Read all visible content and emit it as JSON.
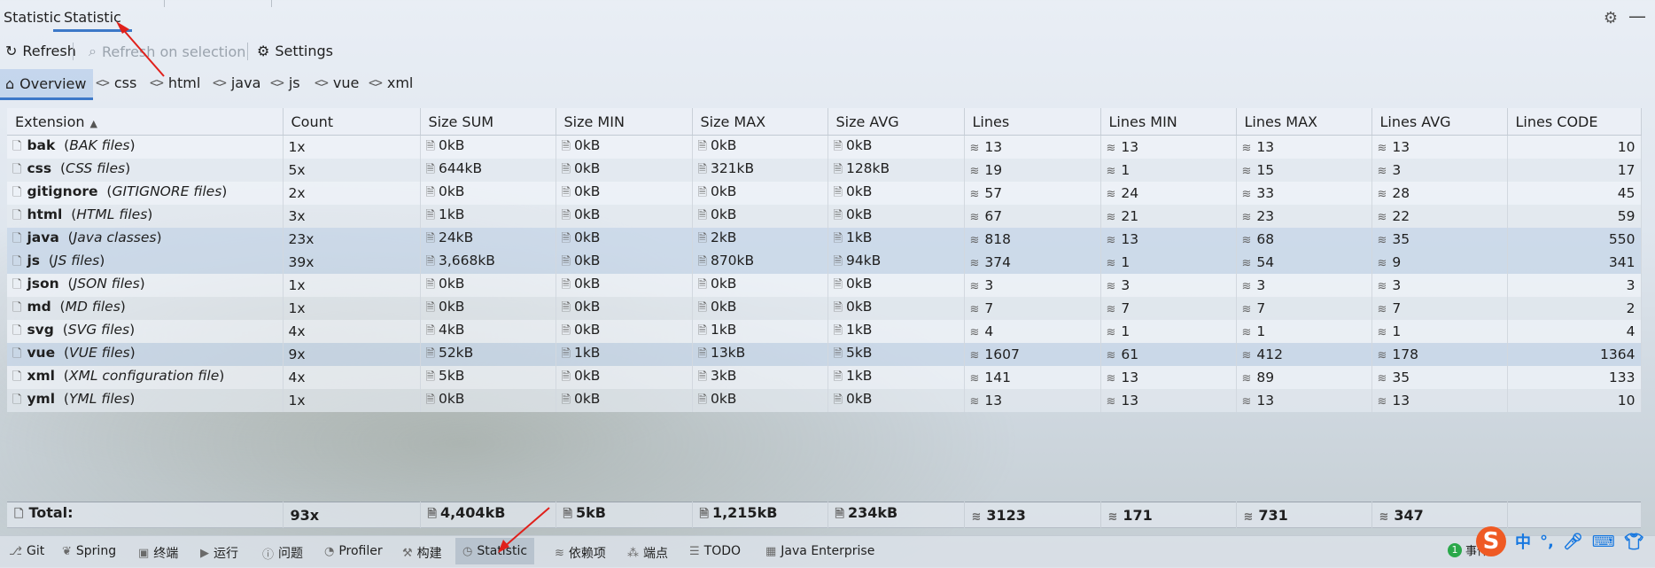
{
  "top_tabs": [
    {
      "label": "Statistic",
      "active": false
    },
    {
      "label": "Statistic",
      "active": true
    }
  ],
  "toolbar": {
    "refresh_label": "Refresh",
    "refresh_on_selection_label": "Refresh on selection",
    "settings_label": "Settings"
  },
  "lang_tabs": [
    {
      "label": "Overview",
      "icon": "home-icon",
      "active": true
    },
    {
      "label": "css",
      "icon": "code-icon"
    },
    {
      "label": "html",
      "icon": "code-icon"
    },
    {
      "label": "java",
      "icon": "code-icon"
    },
    {
      "label": "js",
      "icon": "code-icon"
    },
    {
      "label": "vue",
      "icon": "code-icon"
    },
    {
      "label": "xml",
      "icon": "code-icon"
    }
  ],
  "table": {
    "columns": [
      "Extension",
      "Count",
      "Size SUM",
      "Size MIN",
      "Size MAX",
      "Size AVG",
      "Lines",
      "Lines MIN",
      "Lines MAX",
      "Lines AVG",
      "Lines CODE"
    ],
    "rows": [
      {
        "ext": "bak",
        "desc": "BAK files",
        "count": "1x",
        "size_sum": "0kB",
        "size_min": "0kB",
        "size_max": "0kB",
        "size_avg": "0kB",
        "lines": "13",
        "lines_min": "13",
        "lines_max": "13",
        "lines_avg": "13",
        "lines_code": "10"
      },
      {
        "ext": "css",
        "desc": "CSS files",
        "count": "5x",
        "size_sum": "644kB",
        "size_min": "0kB",
        "size_max": "321kB",
        "size_avg": "128kB",
        "lines": "19",
        "lines_min": "1",
        "lines_max": "15",
        "lines_avg": "3",
        "lines_code": "17"
      },
      {
        "ext": "gitignore",
        "desc": "GITIGNORE files",
        "count": "2x",
        "size_sum": "0kB",
        "size_min": "0kB",
        "size_max": "0kB",
        "size_avg": "0kB",
        "lines": "57",
        "lines_min": "24",
        "lines_max": "33",
        "lines_avg": "28",
        "lines_code": "45"
      },
      {
        "ext": "html",
        "desc": "HTML files",
        "count": "3x",
        "size_sum": "1kB",
        "size_min": "0kB",
        "size_max": "0kB",
        "size_avg": "0kB",
        "lines": "67",
        "lines_min": "21",
        "lines_max": "23",
        "lines_avg": "22",
        "lines_code": "59"
      },
      {
        "ext": "java",
        "desc": "Java classes",
        "count": "23x",
        "size_sum": "24kB",
        "size_min": "0kB",
        "size_max": "2kB",
        "size_avg": "1kB",
        "lines": "818",
        "lines_min": "13",
        "lines_max": "68",
        "lines_avg": "35",
        "lines_code": "550"
      },
      {
        "ext": "js",
        "desc": "JS files",
        "count": "39x",
        "size_sum": "3,668kB",
        "size_min": "0kB",
        "size_max": "870kB",
        "size_avg": "94kB",
        "lines": "374",
        "lines_min": "1",
        "lines_max": "54",
        "lines_avg": "9",
        "lines_code": "341"
      },
      {
        "ext": "json",
        "desc": "JSON files",
        "count": "1x",
        "size_sum": "0kB",
        "size_min": "0kB",
        "size_max": "0kB",
        "size_avg": "0kB",
        "lines": "3",
        "lines_min": "3",
        "lines_max": "3",
        "lines_avg": "3",
        "lines_code": "3"
      },
      {
        "ext": "md",
        "desc": "MD files",
        "count": "1x",
        "size_sum": "0kB",
        "size_min": "0kB",
        "size_max": "0kB",
        "size_avg": "0kB",
        "lines": "7",
        "lines_min": "7",
        "lines_max": "7",
        "lines_avg": "7",
        "lines_code": "2"
      },
      {
        "ext": "svg",
        "desc": "SVG files",
        "count": "4x",
        "size_sum": "4kB",
        "size_min": "0kB",
        "size_max": "1kB",
        "size_avg": "1kB",
        "lines": "4",
        "lines_min": "1",
        "lines_max": "1",
        "lines_avg": "1",
        "lines_code": "4"
      },
      {
        "ext": "vue",
        "desc": "VUE files",
        "count": "9x",
        "size_sum": "52kB",
        "size_min": "1kB",
        "size_max": "13kB",
        "size_avg": "5kB",
        "lines": "1607",
        "lines_min": "61",
        "lines_max": "412",
        "lines_avg": "178",
        "lines_code": "1364"
      },
      {
        "ext": "xml",
        "desc": "XML configuration file",
        "count": "4x",
        "size_sum": "5kB",
        "size_min": "0kB",
        "size_max": "3kB",
        "size_avg": "1kB",
        "lines": "141",
        "lines_min": "13",
        "lines_max": "89",
        "lines_avg": "35",
        "lines_code": "133"
      },
      {
        "ext": "yml",
        "desc": "YML files",
        "count": "1x",
        "size_sum": "0kB",
        "size_min": "0kB",
        "size_max": "0kB",
        "size_avg": "0kB",
        "lines": "13",
        "lines_min": "13",
        "lines_max": "13",
        "lines_avg": "13",
        "lines_code": "10"
      }
    ],
    "total": {
      "label": "Total:",
      "count": "93x",
      "size_sum": "4,404kB",
      "size_min": "5kB",
      "size_max": "1,215kB",
      "size_avg": "234kB",
      "lines": "3123",
      "lines_min": "171",
      "lines_max": "731",
      "lines_avg": "347"
    }
  },
  "bottom_bar": [
    {
      "label": "Git",
      "icon": "git-branch-icon"
    },
    {
      "label": "Spring",
      "icon": "spring-leaf-icon"
    },
    {
      "label": "终端",
      "icon": "terminal-icon"
    },
    {
      "label": "运行",
      "icon": "run-icon"
    },
    {
      "label": "问题",
      "icon": "problems-icon"
    },
    {
      "label": "Profiler",
      "icon": "profiler-icon"
    },
    {
      "label": "构建",
      "icon": "build-hammer-icon"
    },
    {
      "label": "Statistic",
      "icon": "statistic-icon",
      "active": true
    },
    {
      "label": "依赖项",
      "icon": "dependencies-icon"
    },
    {
      "label": "端点",
      "icon": "endpoints-icon"
    },
    {
      "label": "TODO",
      "icon": "todo-list-icon"
    },
    {
      "label": "Java Enterprise",
      "icon": "java-enterprise-icon"
    }
  ],
  "tray": {
    "events_label": "事件",
    "events_count": "1",
    "ime_lang": "中",
    "ime_punct": "°,"
  },
  "colors": {
    "accent": "#3c78c8",
    "annotation_arrow": "#e0201b",
    "ime_badge": "#ef5a24"
  }
}
